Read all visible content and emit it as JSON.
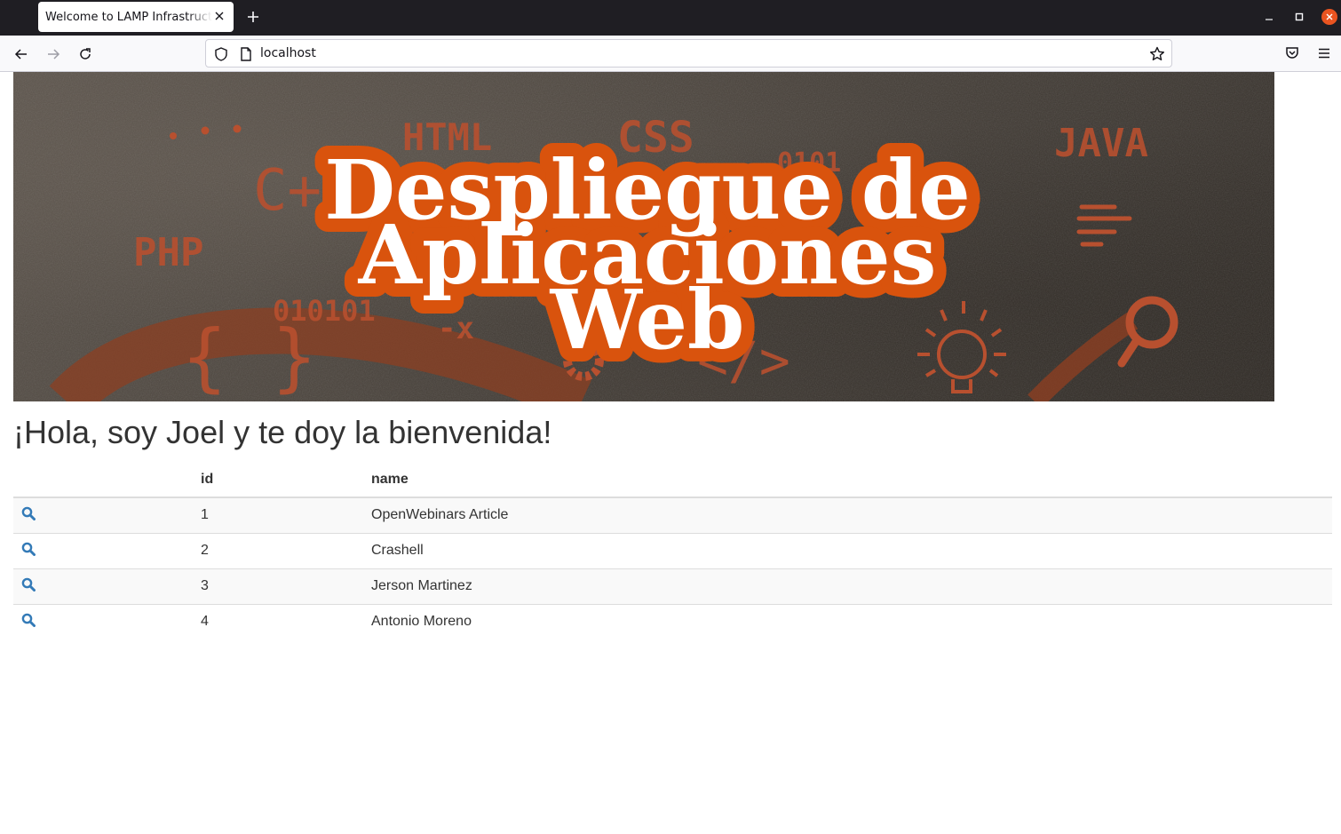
{
  "browser": {
    "tab_title": "Welcome to LAMP Infrastructure",
    "url": "localhost",
    "icons": {
      "back": "arrow-left-icon",
      "forward": "arrow-right-icon",
      "reload": "reload-icon",
      "shield": "shield-icon",
      "page": "page-icon",
      "bookmark": "star-icon",
      "pocket": "pocket-icon",
      "menu": "hamburger-menu-icon",
      "new_tab": "plus-icon",
      "close_tab": "close-icon"
    }
  },
  "banner": {
    "line1": "Despliegue de",
    "line2": "Aplicaciones",
    "line3": "Web",
    "doodles": [
      "HTML",
      "CSS",
      "JAVA",
      "C+",
      "PHP",
      "010101",
      "0101",
      "{ }",
      "</>",
      "-x"
    ],
    "colors": {
      "title_outline": "#d9530d",
      "doodle": "#b8502f",
      "text": "#ffffff"
    }
  },
  "page": {
    "greeting": "¡Hola, soy Joel y te doy la bienvenida!"
  },
  "table": {
    "headers": {
      "action": "",
      "id": "id",
      "name": "name"
    },
    "rows": [
      {
        "id": "1",
        "name": "OpenWebinars Article"
      },
      {
        "id": "2",
        "name": "Crashell"
      },
      {
        "id": "3",
        "name": "Jerson Martinez"
      },
      {
        "id": "4",
        "name": "Antonio Moreno"
      }
    ],
    "action_icon": "search-icon",
    "link_color": "#337ab7"
  }
}
